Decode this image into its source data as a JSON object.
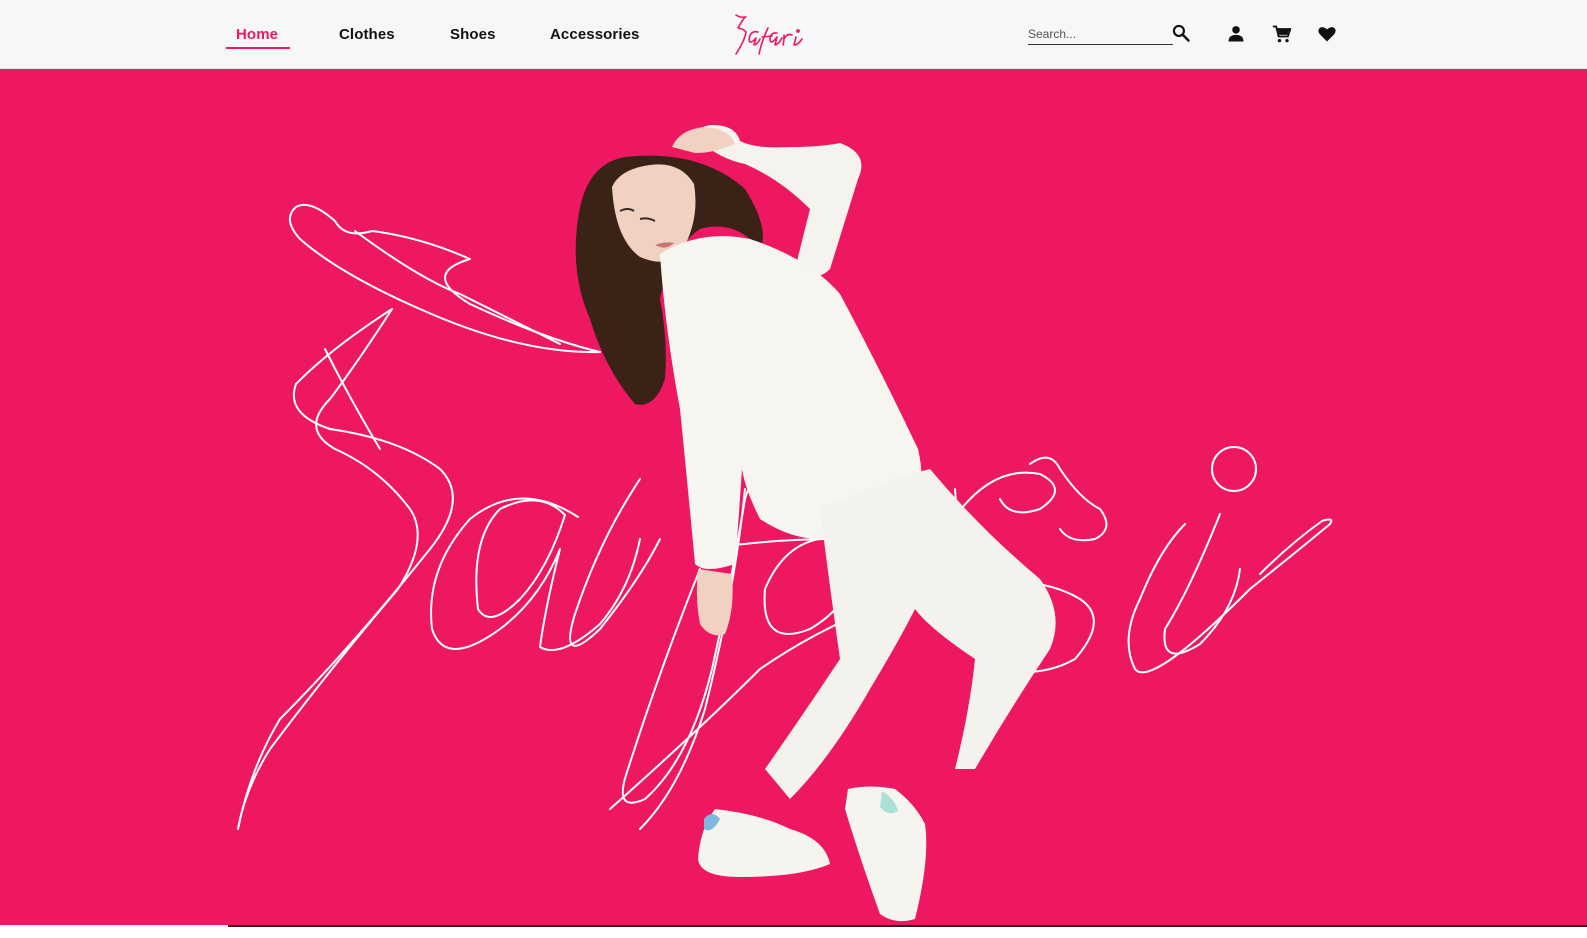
{
  "nav": {
    "links": [
      {
        "label": "Home",
        "active": true
      },
      {
        "label": "Clothes",
        "active": false
      },
      {
        "label": "Shoes",
        "active": false
      },
      {
        "label": "Accessories",
        "active": false
      }
    ],
    "logo_text": "Safari",
    "search": {
      "placeholder": "Search...",
      "value": ""
    },
    "icons": [
      "search-icon",
      "user-icon",
      "cart-icon",
      "heart-icon"
    ]
  },
  "hero": {
    "script_text": "Safari",
    "background_color": "#ed1861",
    "accent_color": "#ee1a5f"
  }
}
